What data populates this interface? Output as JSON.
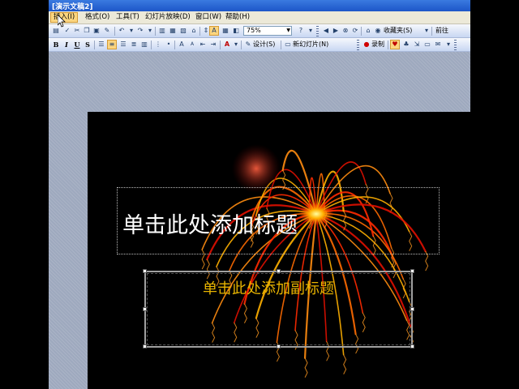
{
  "window": {
    "title": "[演示文稿2]"
  },
  "menu": [
    {
      "label": "插入(I)",
      "active": true
    },
    {
      "label": "格式(O)"
    },
    {
      "label": "工具(T)"
    },
    {
      "label": "幻灯片放映(D)"
    },
    {
      "label": "窗口(W)"
    },
    {
      "label": "帮助(H)"
    }
  ],
  "toolbar1": {
    "zoom": "75%",
    "favorites_label": "收藏夹(S)",
    "forward_label": "前往"
  },
  "toolbar2": {
    "design_label": "设计(S)",
    "new_slide_label": "新幻灯片(N)",
    "record_label": "录制"
  },
  "slide": {
    "title_placeholder": "单击此处添加标题",
    "subtitle_placeholder": "单击此处添加副标题"
  },
  "colors": {
    "title_text": "#ffffff",
    "subtitle_text": "#e8b400",
    "slide_background": "#000000",
    "workspace": "#9ea9be"
  }
}
